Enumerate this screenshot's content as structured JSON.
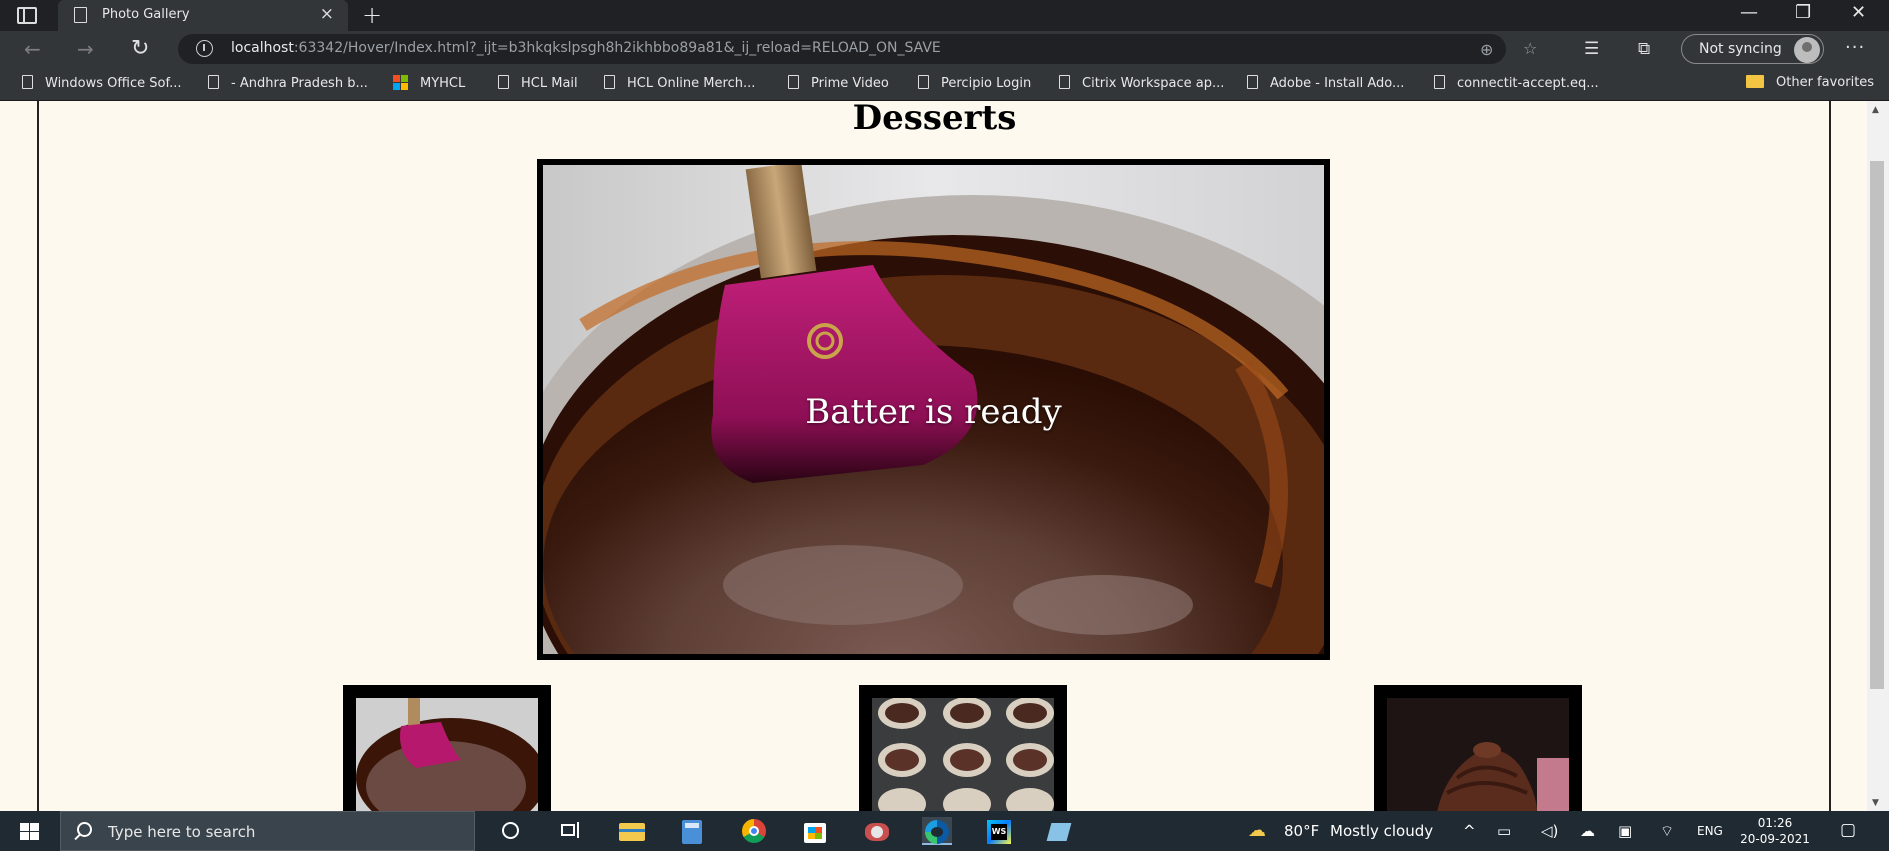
{
  "browser": {
    "tab_title": "Photo Gallery",
    "tab_close": "×",
    "new_tab": "+",
    "window_controls": {
      "minimize": "—",
      "restore": "❐",
      "close": "✕"
    },
    "address": {
      "host": "localhost",
      "rest": ":63342/Hover/Index.html?_ijt=b3hkqkslpsgh8h2ikhbbo89a81&_ij_reload=RELOAD_ON_SAVE"
    },
    "profile_label": "Not syncing",
    "more_label": "···"
  },
  "favorites": [
    {
      "label": "Windows Office Sof...",
      "icon": "page-icon"
    },
    {
      "label": "- Andhra Pradesh b...",
      "icon": "page-icon"
    },
    {
      "label": "MYHCL",
      "icon": "microsoft-icon"
    },
    {
      "label": "HCL Mail",
      "icon": "page-icon"
    },
    {
      "label": "HCL Online Merch...",
      "icon": "page-icon"
    },
    {
      "label": "Prime Video",
      "icon": "page-icon"
    },
    {
      "label": "Percipio Login",
      "icon": "page-icon"
    },
    {
      "label": "Citrix Workspace ap...",
      "icon": "page-icon"
    },
    {
      "label": "Adobe - Install Ado...",
      "icon": "page-icon"
    },
    {
      "label": "connectit-accept.eq...",
      "icon": "page-icon"
    }
  ],
  "other_favorites": "Other favorites",
  "page": {
    "heading": "Desserts",
    "main_caption": "Batter is ready",
    "thumbnails": [
      "batter-thumbnail",
      "cupcake-tray-thumbnail",
      "frosted-cupcake-thumbnail"
    ]
  },
  "taskbar": {
    "search_placeholder": "Type here to search",
    "weather": "80°F",
    "weather_desc": "Mostly cloudy",
    "language": "ENG",
    "time": "01:26",
    "date": "20-09-2021"
  }
}
